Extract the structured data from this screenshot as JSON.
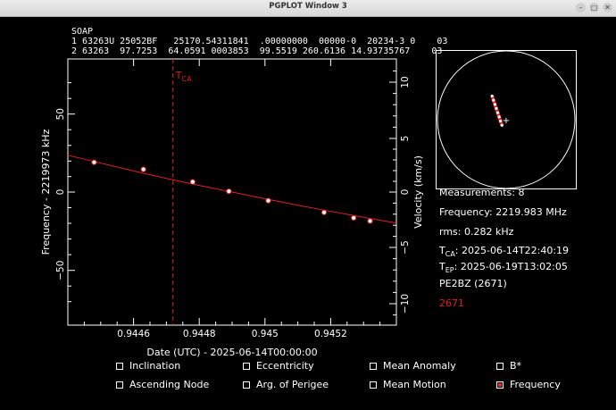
{
  "window": {
    "title": "PGPLOT Window 3",
    "btn_min": "–",
    "btn_max": "□",
    "btn_close": "✕"
  },
  "header": {
    "name": "SOAP",
    "tle_line1": "1 63263U 25052BF   25170.54311841  .00000000  00000-0  20234-3 0    03",
    "tle_line2": "2 63263  97.7253  64.0591 0003853  99.5519 260.6136 14.93735767    03"
  },
  "plot": {
    "xlabel": "Date (UTC) - 2025-06-14T00:00:00",
    "ylabel_left": "Frequency - 2219973 kHz",
    "ylabel_right": "Velocity (km/s)",
    "tca_label": "T",
    "tca_sub": "CA",
    "x_ticks": [
      "0.9446",
      "0.9448",
      "0.945",
      "0.9452"
    ],
    "y_left_ticks": [
      "50",
      "0",
      "−50"
    ],
    "y_right_ticks": [
      "10",
      "5",
      "0",
      "−5",
      "−10"
    ]
  },
  "chart_data": {
    "type": "scatter",
    "xlim": [
      0.94435,
      0.94535
    ],
    "ylim": [
      -85,
      85
    ],
    "x_tca": 0.94467,
    "fit_curve": {
      "x": [
        0.94435,
        0.94445,
        0.94455,
        0.94465,
        0.94475,
        0.94485,
        0.94495,
        0.94505,
        0.94515,
        0.94525,
        0.94535
      ],
      "y": [
        23.5,
        18.5,
        13.5,
        8.7,
        4.2,
        0,
        -4.3,
        -8.4,
        -12.3,
        -16.1,
        -19.8
      ]
    },
    "points": {
      "x": [
        0.94443,
        0.94458,
        0.94473,
        0.94484,
        0.94496,
        0.94513,
        0.94522,
        0.94527
      ],
      "y": [
        19,
        14.5,
        6.5,
        0.5,
        -5.5,
        -13,
        -16.5,
        -18.5
      ]
    },
    "grid": false
  },
  "sky": {
    "track": [
      [
        0.4,
        0.33
      ],
      [
        0.41,
        0.36
      ],
      [
        0.42,
        0.39
      ],
      [
        0.43,
        0.42
      ],
      [
        0.44,
        0.45
      ],
      [
        0.45,
        0.48
      ],
      [
        0.46,
        0.51
      ],
      [
        0.47,
        0.54
      ]
    ],
    "center_mark": "+"
  },
  "info": {
    "measurements": "Measurements: 8",
    "frequency": "Frequency: 2219.983 MHz",
    "rms": "rms: 0.282 kHz",
    "tca_prefix": "T",
    "tca_sub": "CA",
    "tca_value": ": 2025-06-14T22:40:19",
    "tep_prefix": "T",
    "tep_sub": "EP",
    "tep_value": ": 2025-06-19T13:02:05",
    "station": "PE2BZ (2671)",
    "station_id": "2671",
    "station_id_color": "#e02020"
  },
  "options": {
    "inclination": "Inclination",
    "eccentricity": "Eccentricity",
    "mean_anomaly": "Mean Anomaly",
    "bstar": "B*",
    "ascending_node": "Ascending Node",
    "arg_perigee": "Arg. of Perigee",
    "mean_motion": "Mean Motion",
    "frequency": "Frequency"
  },
  "colors": {
    "fit": "#e02020",
    "points": "#ffffff",
    "tca_line": "#e02020"
  }
}
